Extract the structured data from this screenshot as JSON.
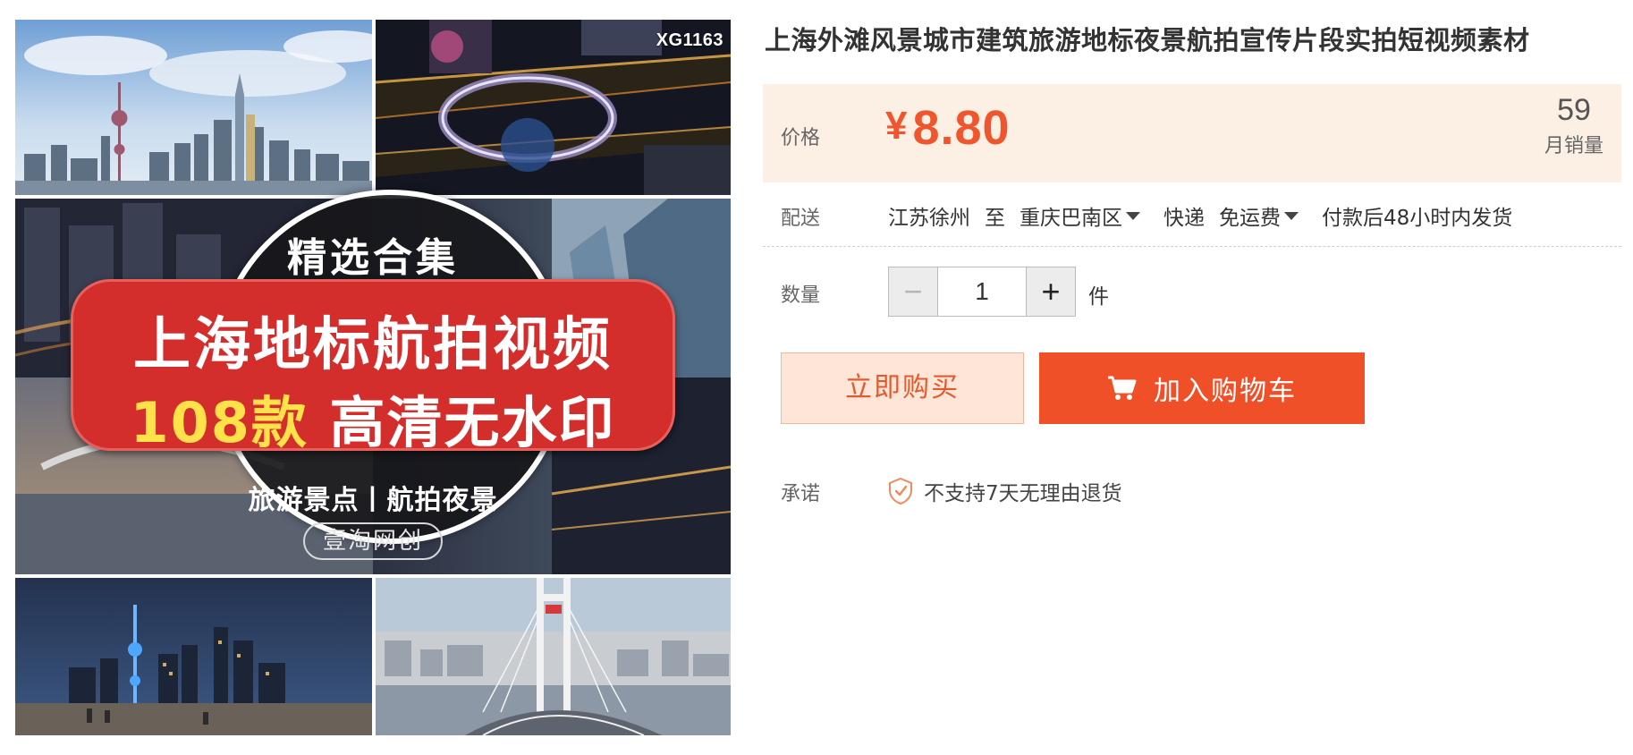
{
  "gallery": {
    "code": "XG1163",
    "badge_top": "精选合集",
    "banner_line1": "上海地标航拍视频",
    "banner_line2_highlight": "108款",
    "banner_line2_rest": "高清无水印",
    "badge_sub": "旅游景点丨航拍夜景",
    "brand": "壹淘网创"
  },
  "product": {
    "title": "上海外滩风景城市建筑旅游地标夜景航拍宣传片段实拍短视频素材"
  },
  "price": {
    "label": "价格",
    "currency": "¥",
    "value": "8.80",
    "sales_count": "59",
    "sales_label": "月销量"
  },
  "shipping": {
    "label": "配送",
    "from": "江苏徐州",
    "to_word": "至",
    "destination": "重庆巴南区",
    "method": "快递",
    "fee": "免运费",
    "dispatch": "付款后48小时内发货"
  },
  "quantity": {
    "label": "数量",
    "value": "1",
    "unit": "件",
    "minus": "−",
    "plus": "+"
  },
  "actions": {
    "buy_now": "立即购买",
    "add_cart": "加入购物车"
  },
  "promise": {
    "label": "承诺",
    "text": "不支持7天无理由退货"
  },
  "colors": {
    "accent": "#f05028",
    "price": "#f0562d",
    "price_bg": "#fcefe3",
    "buy_now_bg": "#fde6d8"
  },
  "icons": {
    "cart": "cart-icon",
    "shield": "shield-check-icon",
    "caret": "caret-down-icon"
  }
}
